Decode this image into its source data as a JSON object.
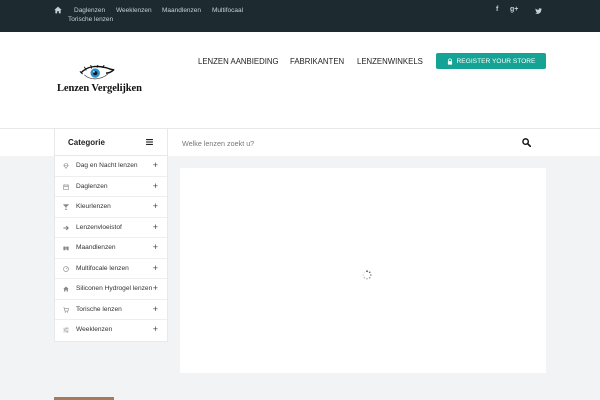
{
  "topbar": {
    "nav": [
      "Daglenzen",
      "Weeklenzen",
      "Maandlenzen",
      "Multifocaal",
      "Torische lenzen"
    ],
    "social": [
      "f",
      "g+",
      "t"
    ],
    "home_icon": "home-icon"
  },
  "header": {
    "logo_text": "Lenzen Vergelijken",
    "nav": [
      "LENZEN AANBIEDING",
      "FABRIKANTEN",
      "LENZENWINKELS"
    ],
    "register_label": "REGISTER YOUR STORE",
    "accent_color": "#14a394",
    "topbar_color": "#1d2a30"
  },
  "category": {
    "title": "Categorie",
    "items": [
      {
        "label": "Dag en Nacht lenzen",
        "icon": "diamond-icon"
      },
      {
        "label": "Daglenzen",
        "icon": "calendar-icon"
      },
      {
        "label": "Kleurlenzen",
        "icon": "cocktail-icon"
      },
      {
        "label": "Lenzenvloeistof",
        "icon": "arrow-right-icon"
      },
      {
        "label": "Maandlenzen",
        "icon": "binoculars-icon"
      },
      {
        "label": "Multifocale lenzen",
        "icon": "dashboard-icon"
      },
      {
        "label": "Siliconen Hydrogel lenzen",
        "icon": "home-icon"
      },
      {
        "label": "Torische lenzen",
        "icon": "cart-icon"
      },
      {
        "label": "Weeklenzen",
        "icon": "sliders-icon"
      }
    ]
  },
  "search": {
    "placeholder": "Welke lenzen zoekt u?"
  }
}
